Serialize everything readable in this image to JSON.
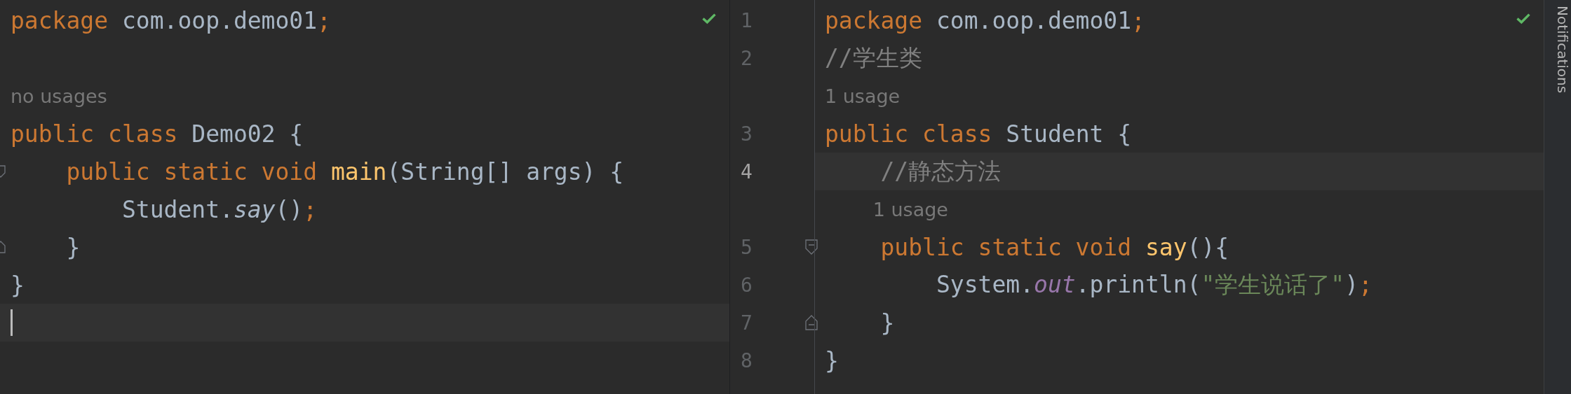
{
  "left_editor": {
    "lines": [
      {
        "kind": "code",
        "tokens": [
          {
            "t": "package",
            "kind": "kw"
          },
          {
            "t": " com.oop.demo01",
            "kind": "plain"
          },
          {
            "t": ";",
            "kind": "kw"
          }
        ]
      },
      {
        "kind": "code"
      },
      {
        "kind": "hint",
        "text": "no usages"
      },
      {
        "kind": "code",
        "tokens": [
          {
            "t": "public class",
            "kind": "kw"
          },
          {
            "t": " Demo02 {",
            "kind": "plain"
          }
        ]
      },
      {
        "kind": "code",
        "fold_start": true,
        "tokens": [
          {
            "t": "    public static void ",
            "kind": "kw"
          },
          {
            "t": "main",
            "kind": "fn"
          },
          {
            "t": "(String[] args) {",
            "kind": "plain"
          }
        ]
      },
      {
        "kind": "code",
        "tokens": [
          {
            "t": "        Student.",
            "kind": "plain"
          },
          {
            "t": "say",
            "kind": "static"
          },
          {
            "t": "()",
            "kind": "plain"
          },
          {
            "t": ";",
            "kind": "kw"
          }
        ]
      },
      {
        "kind": "code",
        "fold_end": true,
        "tokens": [
          {
            "t": "    }",
            "kind": "plain"
          }
        ]
      },
      {
        "kind": "code",
        "tokens": [
          {
            "t": "}",
            "kind": "plain"
          }
        ]
      },
      {
        "kind": "code",
        "current": true
      }
    ]
  },
  "right_editor": {
    "lines": [
      {
        "kind": "code",
        "number": "1",
        "tokens": [
          {
            "t": "package",
            "kind": "kw"
          },
          {
            "t": " com.oop.demo01",
            "kind": "plain"
          },
          {
            "t": ";",
            "kind": "kw"
          }
        ]
      },
      {
        "kind": "code",
        "number": "2",
        "tokens": [
          {
            "t": "//学生类",
            "kind": "comment"
          }
        ]
      },
      {
        "kind": "hint",
        "text": "1 usage"
      },
      {
        "kind": "code",
        "number": "3",
        "tokens": [
          {
            "t": "public class",
            "kind": "kw"
          },
          {
            "t": " Student {",
            "kind": "plain"
          }
        ]
      },
      {
        "kind": "code",
        "number": "4",
        "current": true,
        "tokens": [
          {
            "t": "    //静态方法",
            "kind": "comment"
          }
        ]
      },
      {
        "kind": "hint",
        "text": "1 usage"
      },
      {
        "kind": "code",
        "number": "5",
        "fold_start": true,
        "tokens": [
          {
            "t": "    public static void ",
            "kind": "kw"
          },
          {
            "t": "say",
            "kind": "fn"
          },
          {
            "t": "(){",
            "kind": "plain"
          }
        ]
      },
      {
        "kind": "code",
        "number": "6",
        "tokens": [
          {
            "t": "        System.",
            "kind": "plain"
          },
          {
            "t": "out",
            "kind": "field"
          },
          {
            "t": ".println(",
            "kind": "plain"
          },
          {
            "t": "\"学生说话了\"",
            "kind": "string"
          },
          {
            "t": ")",
            "kind": "plain"
          },
          {
            "t": ";",
            "kind": "kw"
          }
        ]
      },
      {
        "kind": "code",
        "number": "7",
        "fold_end": true,
        "tokens": [
          {
            "t": "    }",
            "kind": "plain"
          }
        ]
      },
      {
        "kind": "code",
        "number": "8",
        "tokens": [
          {
            "t": "}",
            "kind": "plain"
          }
        ]
      }
    ]
  },
  "notifications_tab": {
    "label": "Notifications"
  }
}
